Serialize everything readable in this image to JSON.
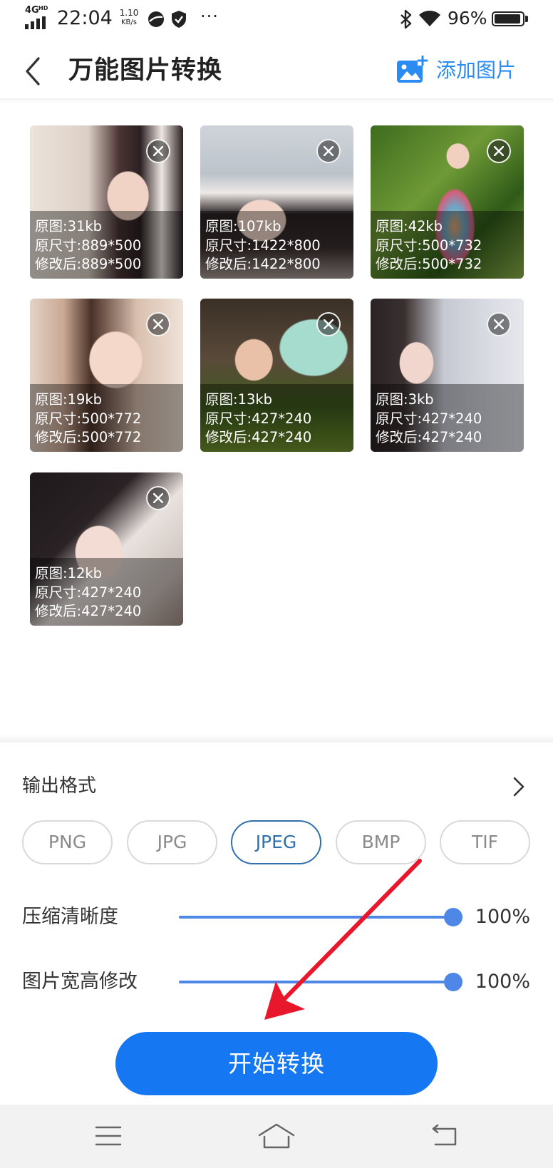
{
  "status_bar": {
    "network": "4G",
    "network_badge": "HD",
    "time": "22:04",
    "speed_value": "1.10",
    "speed_unit": "KB/s",
    "more": "···",
    "battery_percent": "96%",
    "battery_level": 0.96,
    "icons": [
      "signal-icon",
      "app-circle-icon",
      "shield-icon",
      "bluetooth-icon",
      "wifi-icon",
      "battery-icon"
    ]
  },
  "header": {
    "back_icon": "chevron-left-icon",
    "title": "万能图片转换",
    "add_icon": "add-image-icon",
    "add_label": "添加图片"
  },
  "images": [
    {
      "original_size": "原图:31kb",
      "original_dims": "原尺寸:889*500",
      "modified_dims": "修改后:889*500"
    },
    {
      "original_size": "原图:107kb",
      "original_dims": "原尺寸:1422*800",
      "modified_dims": "修改后:1422*800"
    },
    {
      "original_size": "原图:42kb",
      "original_dims": "原尺寸:500*732",
      "modified_dims": "修改后:500*732"
    },
    {
      "original_size": "原图:19kb",
      "original_dims": "原尺寸:500*772",
      "modified_dims": "修改后:500*772"
    },
    {
      "original_size": "原图:13kb",
      "original_dims": "原尺寸:427*240",
      "modified_dims": "修改后:427*240"
    },
    {
      "original_size": "原图:3kb",
      "original_dims": "原尺寸:427*240",
      "modified_dims": "修改后:427*240"
    },
    {
      "original_size": "原图:12kb",
      "original_dims": "原尺寸:427*240",
      "modified_dims": "修改后:427*240"
    }
  ],
  "settings": {
    "output_format": {
      "label": "输出格式",
      "icon": "chevron-right-icon",
      "options": [
        "PNG",
        "JPG",
        "JPEG",
        "BMP",
        "TIF"
      ],
      "selected": "JPEG"
    },
    "compression": {
      "label": "压缩清晰度",
      "value": "100%",
      "level": 1.0
    },
    "resize": {
      "label": "图片宽高修改",
      "value": "100%",
      "level": 1.0
    }
  },
  "start_button": {
    "label": "开始转换"
  },
  "nav_bar": {
    "icons": [
      "menu-icon",
      "home-icon",
      "back-icon"
    ]
  },
  "colors": {
    "accent": "#2a8cf3",
    "button": "#1677f2",
    "selected_format": "#2f6fad",
    "slider": "#4f87e6",
    "annotation": "#e8172b"
  }
}
